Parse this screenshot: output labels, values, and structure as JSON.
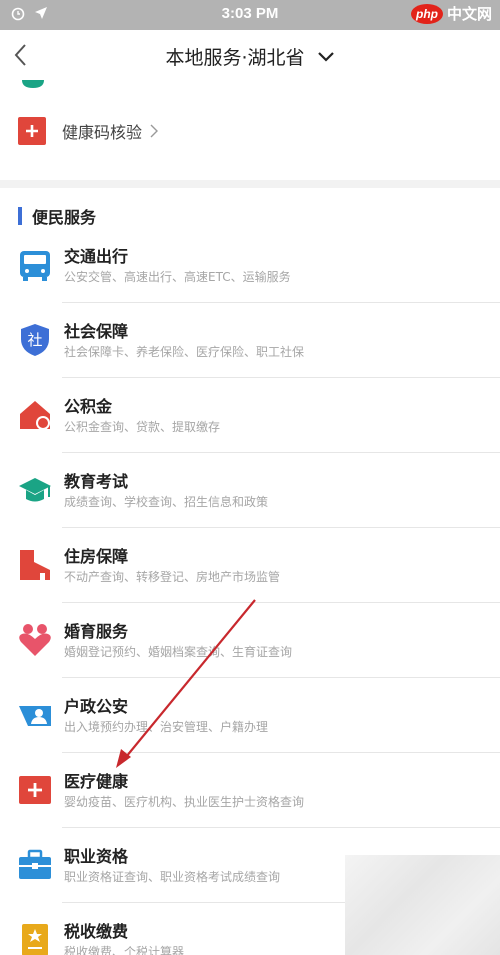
{
  "status": {
    "time": "3:03 PM",
    "watermark_logo": "php",
    "watermark_text": "中文网"
  },
  "nav": {
    "title": "本地服务·湖北省"
  },
  "top_card": {
    "verify_label": "健康码核验"
  },
  "section": {
    "title": "便民服务"
  },
  "services": [
    {
      "title": "交通出行",
      "desc": "公安交管、高速出行、高速ETC、运输服务",
      "icon": "bus-icon"
    },
    {
      "title": "社会保障",
      "desc": "社会保障卡、养老保险、医疗保险、职工社保",
      "icon": "shield-icon"
    },
    {
      "title": "公积金",
      "desc": "公积金查询、贷款、提取缴存",
      "icon": "house-fund-icon"
    },
    {
      "title": "教育考试",
      "desc": "成绩查询、学校查询、招生信息和政策",
      "icon": "graduation-cap-icon"
    },
    {
      "title": "住房保障",
      "desc": "不动产查询、转移登记、房地产市场监管",
      "icon": "building-icon"
    },
    {
      "title": "婚育服务",
      "desc": "婚姻登记预约、婚姻档案查询、生育证查询",
      "icon": "heart-people-icon"
    },
    {
      "title": "户政公安",
      "desc": "出入境预约办理、治安管理、户籍办理",
      "icon": "id-card-icon"
    },
    {
      "title": "医疗健康",
      "desc": "婴幼疫苗、医疗机构、执业医生护士资格查询",
      "icon": "medical-cross-icon"
    },
    {
      "title": "职业资格",
      "desc": "职业资格证查询、职业资格考试成绩查询",
      "icon": "briefcase-icon"
    },
    {
      "title": "税收缴费",
      "desc": "税收缴费、个税计算器",
      "icon": "tax-document-icon"
    }
  ],
  "colors": {
    "accent_blue": "#3d6fd6",
    "status_bar": "#b3b3b3",
    "red": "#e0463b",
    "teal": "#1aa485",
    "orange": "#e8a91b",
    "arrow": "#c8282d"
  }
}
